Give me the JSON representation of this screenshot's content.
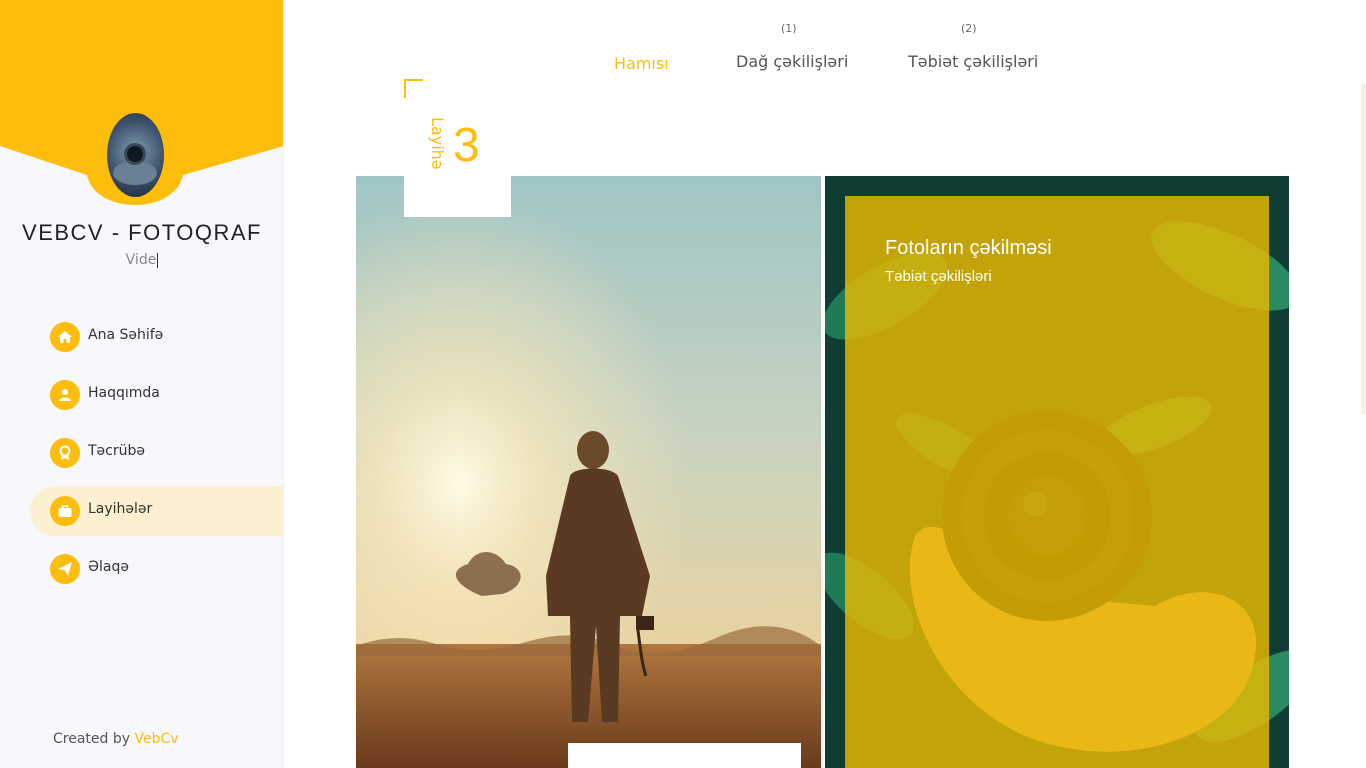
{
  "colors": {
    "accent": "#fcbd0c",
    "sidebar_bg": "#f7f8fc",
    "active_nav_bg": "#fbf0d0",
    "card_overlay": "#eaba00"
  },
  "sidebar": {
    "title": "VEBCV - FOTOQRAF",
    "subtitle": "Vide",
    "nav": [
      {
        "label": "Ana Səhifə",
        "icon": "home-icon",
        "active": false
      },
      {
        "label": "Haqqımda",
        "icon": "user-icon",
        "active": false
      },
      {
        "label": "Təcrübə",
        "icon": "award-icon",
        "active": false
      },
      {
        "label": "Layihələr",
        "icon": "briefcase-icon",
        "active": true
      },
      {
        "label": "Əlaqə",
        "icon": "paper-plane-icon",
        "active": false
      }
    ],
    "credit": {
      "prefix": "Created by ",
      "brand": "VebCv"
    }
  },
  "filters": [
    {
      "label": "Hamısı",
      "count": "",
      "active": true
    },
    {
      "label": "Dağ çəkilişləri",
      "count": "(1)",
      "active": false
    },
    {
      "label": "Təbiət çəkilişləri",
      "count": "(2)",
      "active": false
    }
  ],
  "projects": {
    "count_label": "Layihə",
    "count_value": "3",
    "cards": [
      {
        "title": "",
        "category": "",
        "image": "photographer-silhouette-sunset"
      },
      {
        "title": "Fotoların çəkilməsi",
        "category": "Təbiət çəkilişləri",
        "image": "camera-lens-in-hand"
      }
    ]
  }
}
